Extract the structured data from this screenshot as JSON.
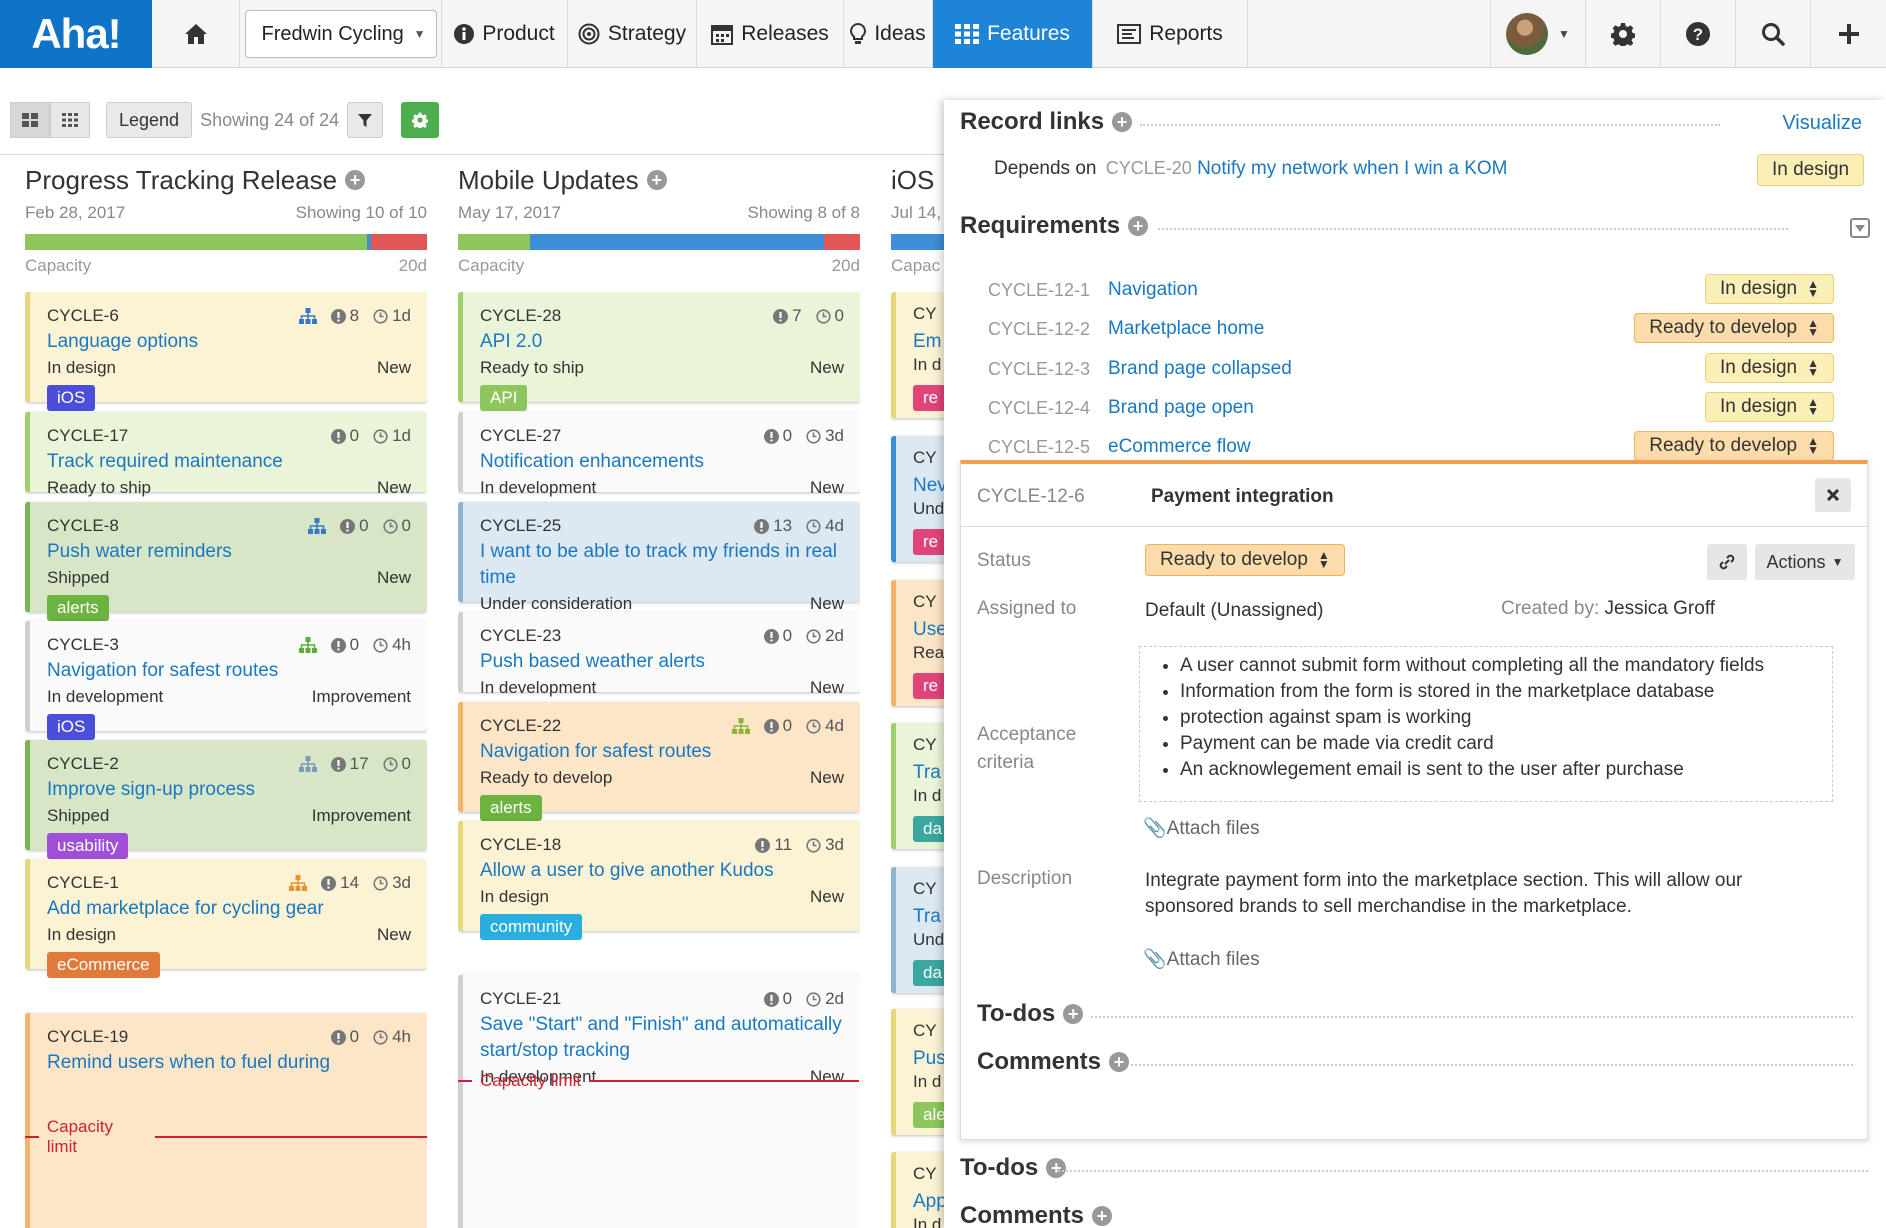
{
  "nav": {
    "logo": "Aha!",
    "workspace": "Fredwin Cycling",
    "items": [
      {
        "label": "Product",
        "icon": "info-icon"
      },
      {
        "label": "Strategy",
        "icon": "target-icon"
      },
      {
        "label": "Releases",
        "icon": "calendar-icon"
      },
      {
        "label": "Ideas",
        "icon": "lightbulb-icon"
      },
      {
        "label": "Features",
        "icon": "grid-icon",
        "active": true
      },
      {
        "label": "Reports",
        "icon": "report-icon"
      }
    ]
  },
  "toolbar": {
    "legend": "Legend",
    "showing": "Showing 24 of 24"
  },
  "columns": [
    {
      "title": "Progress Tracking Release",
      "date": "Feb 28, 2017",
      "showing": "Showing 10 of 10",
      "capacity_label": "Capacity",
      "capacity_value": "20d",
      "capacity_fill": [
        {
          "color": "#8cc65c",
          "pct": 0.85
        },
        {
          "color": "#3c8fd6",
          "pct": 0.01
        },
        {
          "color": "#e05555",
          "pct": 0.14
        }
      ]
    },
    {
      "title": "Mobile Updates",
      "date": "May 17, 2017",
      "showing": "Showing 8 of 8",
      "capacity_label": "Capacity",
      "capacity_value": "20d",
      "capacity_fill": [
        {
          "color": "#8cc65c",
          "pct": 0.18
        },
        {
          "color": "#3c8fd6",
          "pct": 0.73
        },
        {
          "color": "#e05555",
          "pct": 0.09
        }
      ]
    },
    {
      "title": "iOS",
      "date": "Jul 14,",
      "capacity_label": "Capac"
    }
  ],
  "cards_col1": [
    {
      "id": "CYCLE-6",
      "name": "Language options",
      "status": "In design",
      "type": "New",
      "tag": "iOS",
      "tagcolor": "#4b4ed8",
      "bg": "#fbf3d4",
      "lb": "#e8d67c",
      "s1": "8",
      "s2": "1d",
      "hier": "#3a78c8"
    },
    {
      "id": "CYCLE-17",
      "name": "Track required maintenance",
      "status": "Ready to ship",
      "type": "New",
      "bg": "#eaf4d8",
      "lb": "#9fcf6a",
      "s1": "0",
      "s2": "1d"
    },
    {
      "id": "CYCLE-8",
      "name": "Push water reminders",
      "status": "Shipped",
      "type": "New",
      "tag": "alerts",
      "tagcolor": "#6db33f",
      "bg": "#d8e6c8",
      "lb": "#7bb456",
      "s1": "0",
      "s2": "0",
      "hier": "#3a78c8"
    },
    {
      "id": "CYCLE-3",
      "name": "Navigation for safest routes",
      "status": "In development",
      "type": "Improvement",
      "tag": "iOS",
      "tagcolor": "#4b4ed8",
      "bg": "#fafafa",
      "lb": "#cfcfcf",
      "s1": "0",
      "s2": "4h",
      "hier": "#5aad3a"
    },
    {
      "id": "CYCLE-2",
      "name": "Improve sign-up process",
      "status": "Shipped",
      "type": "Improvement",
      "tag": "usability",
      "tagcolor": "#a050d8",
      "bg": "#d8e6c8",
      "lb": "#7bb456",
      "s1": "17",
      "s2": "0",
      "hier": "#7a9ab8"
    },
    {
      "id": "CYCLE-1",
      "name": "Add marketplace for cycling gear",
      "status": "In design",
      "type": "New",
      "tag": "eCommerce",
      "tagcolor": "#e07a3a",
      "bg": "#fbf3d4",
      "lb": "#e8d67c",
      "s1": "14",
      "s2": "3d",
      "hier": "#e8902a"
    },
    {
      "id": "CYCLE-19",
      "name": "Remind users when to fuel during",
      "bg": "#fde5c8",
      "lb": "#f2b46a",
      "s1": "0",
      "s2": "4h"
    }
  ],
  "cards_col2": [
    {
      "id": "CYCLE-28",
      "name": "API 2.0",
      "status": "Ready to ship",
      "type": "New",
      "tag": "API",
      "tagcolor": "#8cc65c",
      "bg": "#eaf4d8",
      "lb": "#9fcf6a",
      "s1": "7",
      "s2": "0"
    },
    {
      "id": "CYCLE-27",
      "name": "Notification enhancements",
      "status": "In development",
      "type": "New",
      "bg": "#fafafa",
      "lb": "#cfcfcf",
      "s1": "0",
      "s2": "3d"
    },
    {
      "id": "CYCLE-25",
      "name": "I want to be able to track my friends in real time",
      "status": "Under consideration",
      "type": "New",
      "bg": "#dce8f2",
      "lb": "#8fb3d2",
      "s1": "13",
      "s2": "4d"
    },
    {
      "id": "CYCLE-23",
      "name": "Push based weather alerts",
      "status": "In development",
      "type": "New",
      "bg": "#fafafa",
      "lb": "#cfcfcf",
      "s1": "0",
      "s2": "2d"
    },
    {
      "id": "CYCLE-22",
      "name": "Navigation for safest routes",
      "status": "Ready to develop",
      "type": "New",
      "tag": "alerts",
      "tagcolor": "#6db33f",
      "bg": "#fde5c8",
      "lb": "#f2b46a",
      "s1": "0",
      "s2": "4d",
      "hier": "#8cb43a"
    },
    {
      "id": "CYCLE-18",
      "name": "Allow a user to give another Kudos",
      "status": "In design",
      "type": "New",
      "tag": "community",
      "tagcolor": "#2aaee0",
      "bg": "#fbf3d4",
      "lb": "#e8d67c",
      "s1": "11",
      "s2": "3d"
    },
    {
      "id": "CYCLE-21",
      "name": "Save \"Start\" and \"Finish\" and automatically start/stop tracking",
      "status": "In development",
      "type": "New",
      "bg": "#fafafa",
      "lb": "#cfcfcf",
      "s1": "0",
      "s2": "2d"
    }
  ],
  "capacity_limit": "Capacity limit",
  "col3_cards": [
    {
      "t1": "CY",
      "t2": "Em",
      "t3": "In d",
      "tag": "re",
      "tagcolor": "#e0457a",
      "bg": "#fbf3d4",
      "lb": "#e8d67c"
    },
    {
      "t1": "CY",
      "t2": "Nev",
      "t3": "Und",
      "tag": "re",
      "tagcolor": "#e0457a",
      "bg": "#dce8f2",
      "lb": "#3c8fd6"
    },
    {
      "t1": "CY",
      "t2": "Use",
      "t3": "Rea",
      "tag": "re",
      "tagcolor": "#e0457a",
      "bg": "#fde5c8",
      "lb": "#f2b46a"
    },
    {
      "t1": "CY",
      "t2": "Tra",
      "t3": "In d",
      "tag": "da",
      "tagcolor": "#3aa8a0",
      "bg": "#eaf4d8",
      "lb": "#9fcf6a"
    },
    {
      "t1": "CY",
      "t2": "Tra",
      "t3": "Und",
      "tag": "da",
      "tagcolor": "#3aa8a0",
      "bg": "#dce8f2",
      "lb": "#8fb3d2"
    },
    {
      "t1": "CY",
      "t2": "Pus",
      "t3": "In d",
      "tag": "ale",
      "tagcolor": "#8cc65c",
      "bg": "#fbf3d4",
      "lb": "#e8d67c"
    },
    {
      "t1": "CY",
      "t2": "App",
      "t3": "In d",
      "bg": "#fbf3d4",
      "lb": "#e8d67c"
    }
  ],
  "panel": {
    "record_links": "Record links",
    "visualize": "Visualize",
    "depends_on": "Depends on",
    "dep_id": "CYCLE-20",
    "dep_name": "Notify my network when I win a KOM",
    "dep_status": "In design",
    "requirements": "Requirements",
    "reqs": [
      {
        "id": "CYCLE-12-1",
        "name": "Navigation",
        "status": "In design",
        "s": "yel"
      },
      {
        "id": "CYCLE-12-2",
        "name": "Marketplace home",
        "status": "Ready to develop",
        "s": "org"
      },
      {
        "id": "CYCLE-12-3",
        "name": "Brand page collapsed",
        "status": "In design",
        "s": "yel"
      },
      {
        "id": "CYCLE-12-4",
        "name": "Brand page open",
        "status": "In design",
        "s": "yel"
      },
      {
        "id": "CYCLE-12-5",
        "name": "eCommerce flow",
        "status": "Ready to develop",
        "s": "org"
      }
    ],
    "detail": {
      "id": "CYCLE-12-6",
      "title": "Payment integration",
      "status_label": "Status",
      "status": "Ready to develop",
      "actions": "Actions",
      "assigned_label": "Assigned to",
      "assigned": "Default (Unassigned)",
      "created_by_label": "Created by:",
      "created_by": "Jessica Groff",
      "acceptance_label_1": "Acceptance",
      "acceptance_label_2": "criteria",
      "criteria": [
        "A user cannot submit form without completing all the mandatory fields",
        "Information from the form is stored in the marketplace database",
        "protection against spam is working",
        "Payment can be made via credit card",
        "An acknowlegement email is sent to the user after purchase"
      ],
      "attach": "Attach files",
      "description_label": "Description",
      "description_1": "Integrate payment form into the marketplace section. This will allow our",
      "description_2": "sponsored brands to sell merchandise in the marketplace.",
      "todos": "To-dos",
      "comments": "Comments"
    },
    "todos": "To-dos",
    "comments": "Comments"
  }
}
